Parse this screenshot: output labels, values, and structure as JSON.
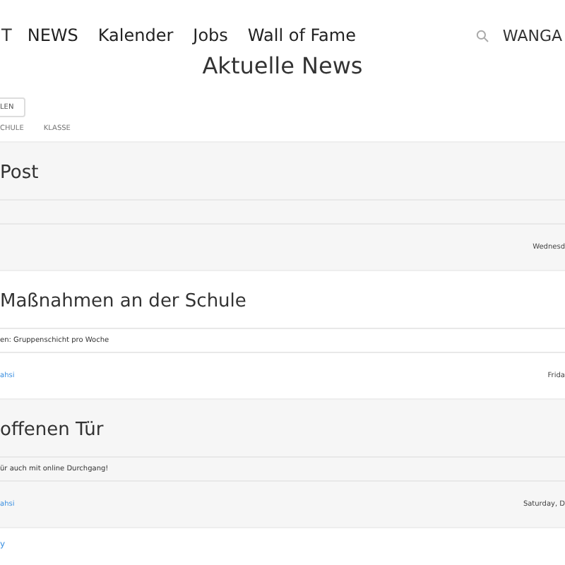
{
  "nav": {
    "brand": "T",
    "links": [
      "NEWS",
      "Kalender",
      "Jobs",
      "Wall of Fame"
    ],
    "user": "WANGA"
  },
  "title": "Aktuelle News",
  "button": "LEN",
  "tabs": [
    {
      "label": "CHULE",
      "selected": false
    },
    {
      "label": "KLASSE",
      "selected": false
    }
  ],
  "posts": [
    {
      "title": "Post",
      "date": "Wednesd"
    },
    {
      "title": "Maßnahmen an der Schule",
      "text": "en: Gruppenschicht pro Woche",
      "author": "ahsi",
      "date": "Frida"
    },
    {
      "title": "offenen Tür",
      "text": "ür auch mit online Durchgang!",
      "author": "ahsi",
      "date": "Saturday, D"
    }
  ],
  "more_link": "y"
}
